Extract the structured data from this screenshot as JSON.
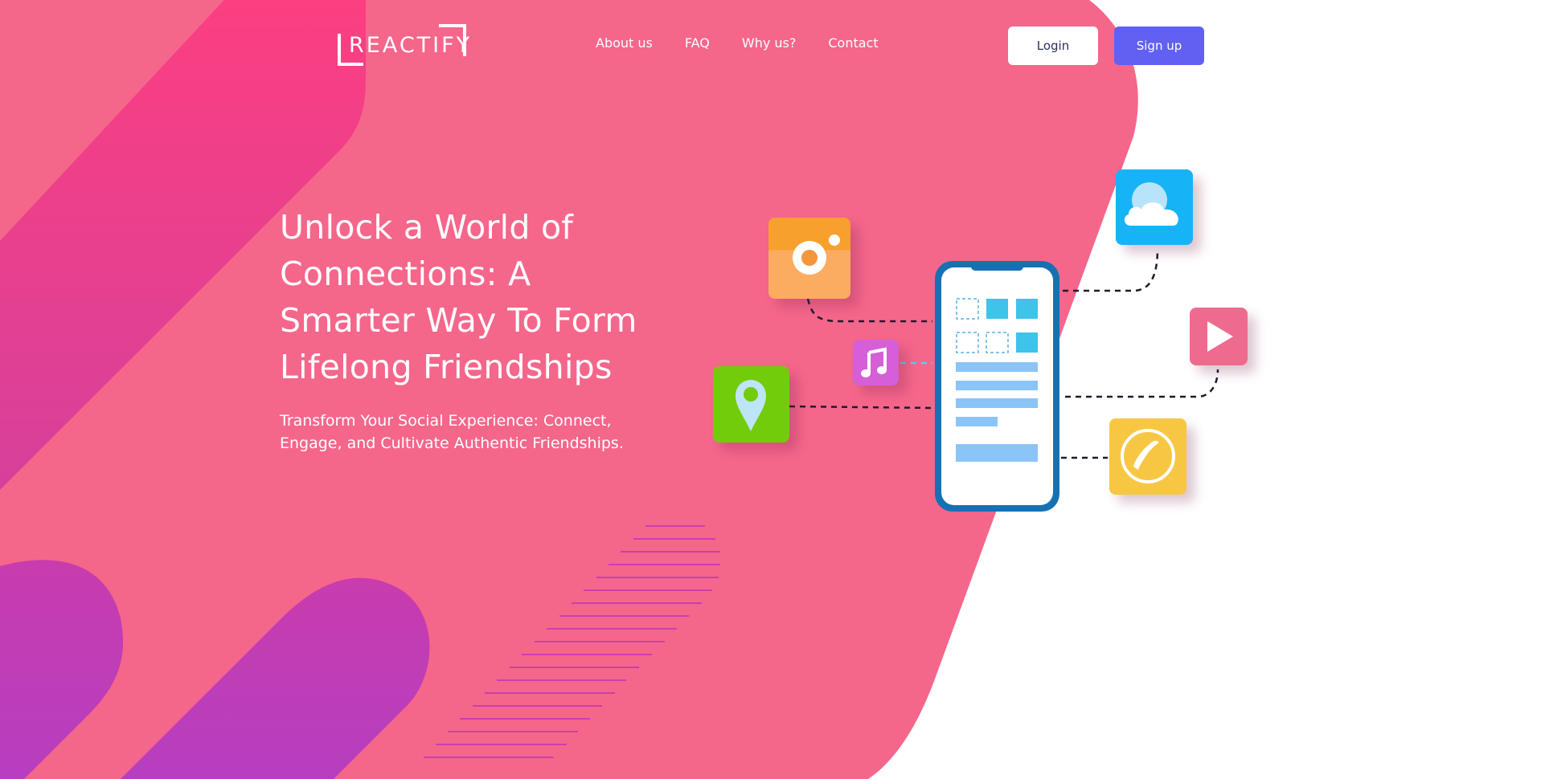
{
  "brand": {
    "logo_text": "REACTIFY"
  },
  "nav": {
    "items": [
      {
        "label": "About us"
      },
      {
        "label": "FAQ"
      },
      {
        "label": "Why us?"
      },
      {
        "label": "Contact"
      }
    ]
  },
  "auth": {
    "login_label": "Login",
    "signup_label": "Sign up"
  },
  "hero": {
    "title": "Unlock a World of Connections: A Smarter Way To Form Lifelong Friendships",
    "subtitle": "Transform Your Social Experience: Connect, Engage, and Cultivate Authentic Friendships."
  },
  "illustration": {
    "icons": [
      "camera-icon",
      "cloud-icon",
      "music-note-icon",
      "play-icon",
      "location-pin-icon",
      "phone-icon",
      "smartphone-icon"
    ]
  },
  "colors": {
    "hero_pink": "#f5668b",
    "stripe_magenta": "#f03d86",
    "stripe_purple": "#b83bb8",
    "signup_button": "#6160f3",
    "login_button": "#ffffff",
    "camera_icon": "#f8a466",
    "cloud_icon": "#1ab0f0",
    "music_icon": "#d55fd6",
    "play_icon": "#ee6b8e",
    "location_icon": "#72cc0b",
    "phone_icon": "#f7c744",
    "phone_frame": "#1671b3"
  }
}
